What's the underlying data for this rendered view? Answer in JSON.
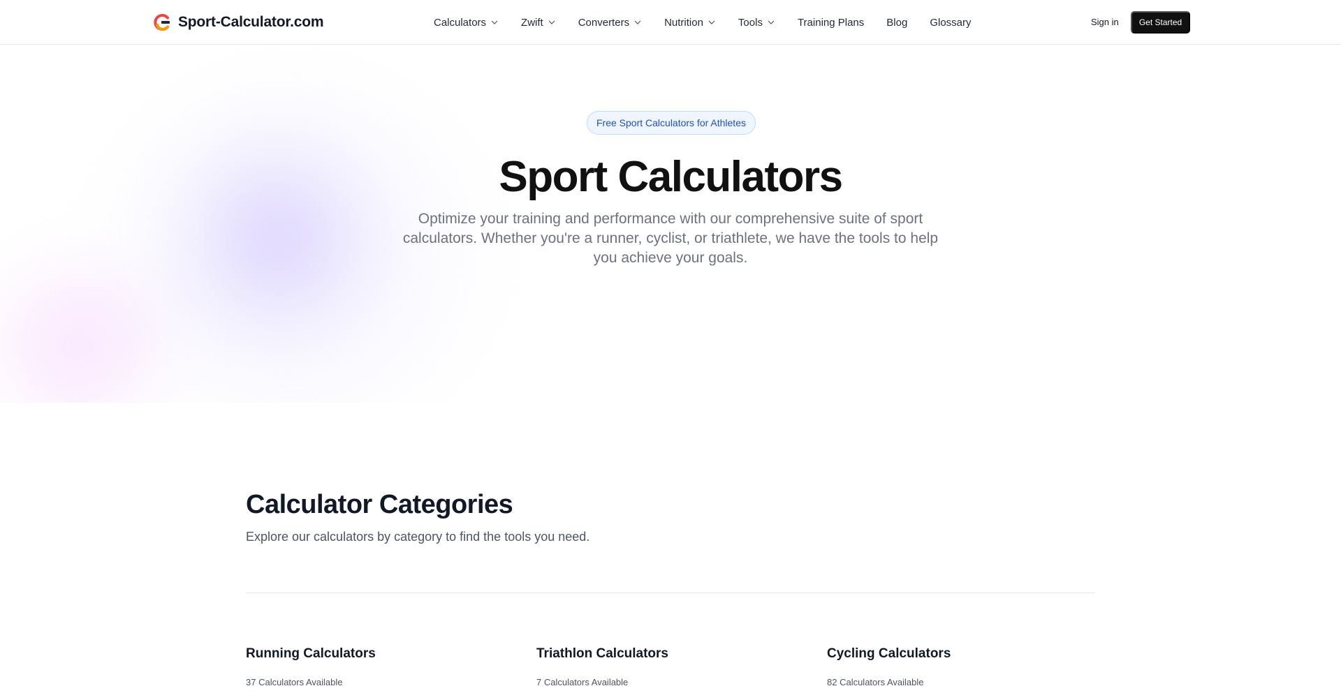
{
  "header": {
    "logo_text": "Sport-Calculator.com",
    "nav": [
      {
        "label": "Calculators",
        "dropdown": true
      },
      {
        "label": "Zwift",
        "dropdown": true
      },
      {
        "label": "Converters",
        "dropdown": true
      },
      {
        "label": "Nutrition",
        "dropdown": true
      },
      {
        "label": "Tools",
        "dropdown": true
      },
      {
        "label": "Training Plans",
        "dropdown": false
      },
      {
        "label": "Blog",
        "dropdown": false
      },
      {
        "label": "Glossary",
        "dropdown": false
      }
    ],
    "sign_in_label": "Sign in",
    "get_started_label": "Get Started"
  },
  "hero": {
    "badge": "Free Sport Calculators for Athletes",
    "title": "Sport Calculators",
    "subtitle": "Optimize your training and performance with our comprehensive suite of sport calculators. Whether you're a runner, cyclist, or triathlete, we have the tools to help you achieve your goals."
  },
  "categories": {
    "title": "Calculator Categories",
    "subtitle": "Explore our calculators by category to find the tools you need.",
    "items": [
      {
        "title": "Running Calculators",
        "count": "37 Calculators Available"
      },
      {
        "title": "Triathlon Calculators",
        "count": "7 Calculators Available"
      },
      {
        "title": "Cycling Calculators",
        "count": "82 Calculators Available"
      }
    ]
  },
  "colors": {
    "accent": "#111111",
    "badge_text": "#1d4ed8",
    "badge_bg": "#eff6ff",
    "logo_red": "#ef4444",
    "logo_orange": "#f59e0b",
    "logo_dark": "#1f2937"
  }
}
